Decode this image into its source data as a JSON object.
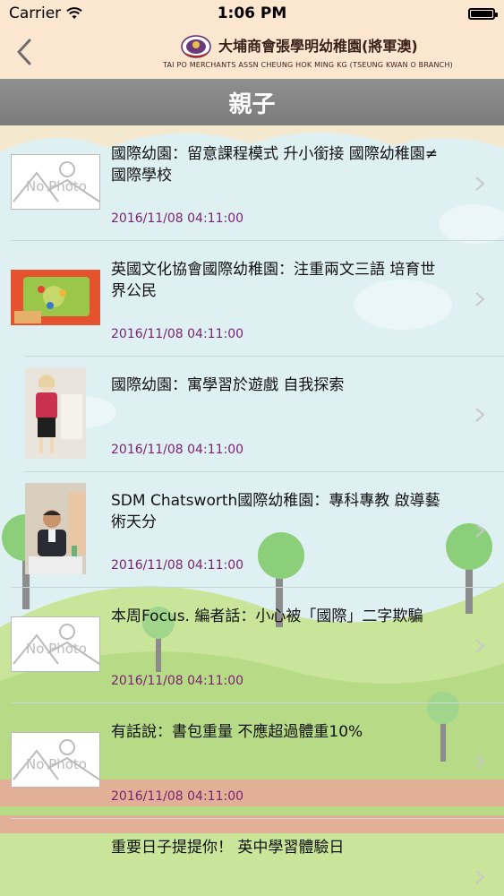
{
  "status_bar": {
    "carrier": "Carrier",
    "time": "1:06 PM"
  },
  "nav": {
    "school_name_zh": "大埔商會張學明幼稚園(將軍澳)",
    "school_name_en": "TAI PO MERCHANTS ASSN CHEUNG HOK MING KG (TSEUNG KWAN O BRANCH)"
  },
  "section": {
    "title": "親子"
  },
  "articles": [
    {
      "title": "國際幼園：留意課程模式 升小銜接 國際幼稚園≠國際學校",
      "date": "2016/11/08 04:11:00",
      "thumbnail": "No Photo"
    },
    {
      "title": "英國文化協會國際幼稚園：注重兩文三語 培育世界公民",
      "date": "2016/11/08 04:11:00",
      "thumbnail": "toys-photo"
    },
    {
      "title": "國際幼園：寓學習於遊戲 自我探索",
      "date": "2016/11/08 04:11:00",
      "thumbnail": "woman-photo"
    },
    {
      "title": "SDM Chatsworth國際幼稚園：專科專教 啟導藝術天分",
      "date": "2016/11/08 04:11:00",
      "thumbnail": "man-photo"
    },
    {
      "title": "本周Focus.  編者話：小心被「國際」二字欺騙",
      "date": "2016/11/08 04:11:00",
      "thumbnail": "No Photo"
    },
    {
      "title": "有話說：書包重量 不應超過體重10%",
      "date": "2016/11/08 04:11:00",
      "thumbnail": "No Photo"
    },
    {
      "title": "重要日子提提你！ 英中學習體驗日",
      "date": "",
      "thumbnail": ""
    }
  ],
  "colors": {
    "nav_bg": "#fbe6cf",
    "header_bg": "#858585",
    "date_color": "#7a2372"
  }
}
